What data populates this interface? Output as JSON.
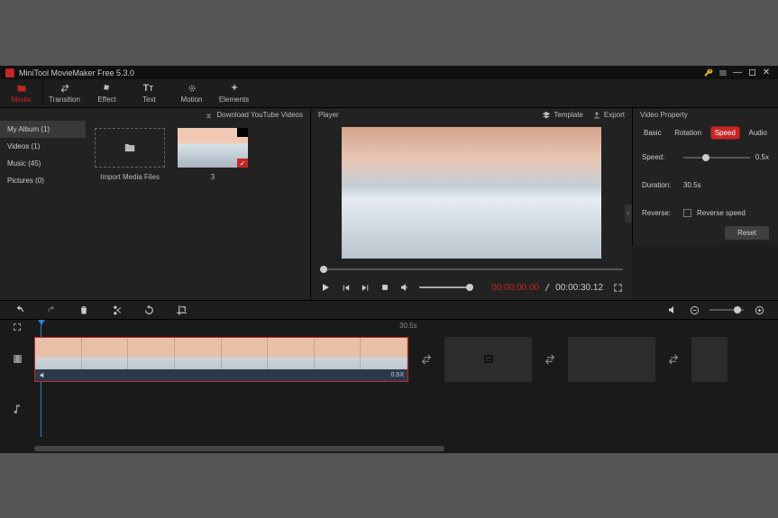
{
  "title": "MiniTool MovieMaker Free 5.3.0",
  "topTabs": [
    {
      "label": "Media",
      "icon": "folder"
    },
    {
      "label": "Transition",
      "icon": "swap"
    },
    {
      "label": "Effect",
      "icon": "square"
    },
    {
      "label": "Text",
      "icon": "text"
    },
    {
      "label": "Motion",
      "icon": "circle"
    },
    {
      "label": "Elements",
      "icon": "sparkle"
    }
  ],
  "downloadYT": "Download YouTube Videos",
  "sidebar": [
    {
      "label": "My Album (1)"
    },
    {
      "label": "Videos (1)"
    },
    {
      "label": "Music (45)"
    },
    {
      "label": "Pictures (0)"
    }
  ],
  "importLabel": "Import Media Files",
  "clipLabel": "3",
  "player": {
    "title": "Player",
    "template": "Template",
    "export": "Export",
    "current": "00:00:00.00",
    "total": "00:00:30.12"
  },
  "props": {
    "title": "Video Property",
    "tabs": [
      "Basic",
      "Rotation",
      "Speed",
      "Audio"
    ],
    "speedLabel": "Speed:",
    "speedVal": "0.5x",
    "durationLabel": "Duration:",
    "durationVal": "30.5s",
    "reverseLabel": "Reverse:",
    "reverseOpt": "Reverse speed",
    "reset": "Reset"
  },
  "ruler": {
    "mark": "30.5s"
  },
  "clip": {
    "speed": "0.5X"
  }
}
